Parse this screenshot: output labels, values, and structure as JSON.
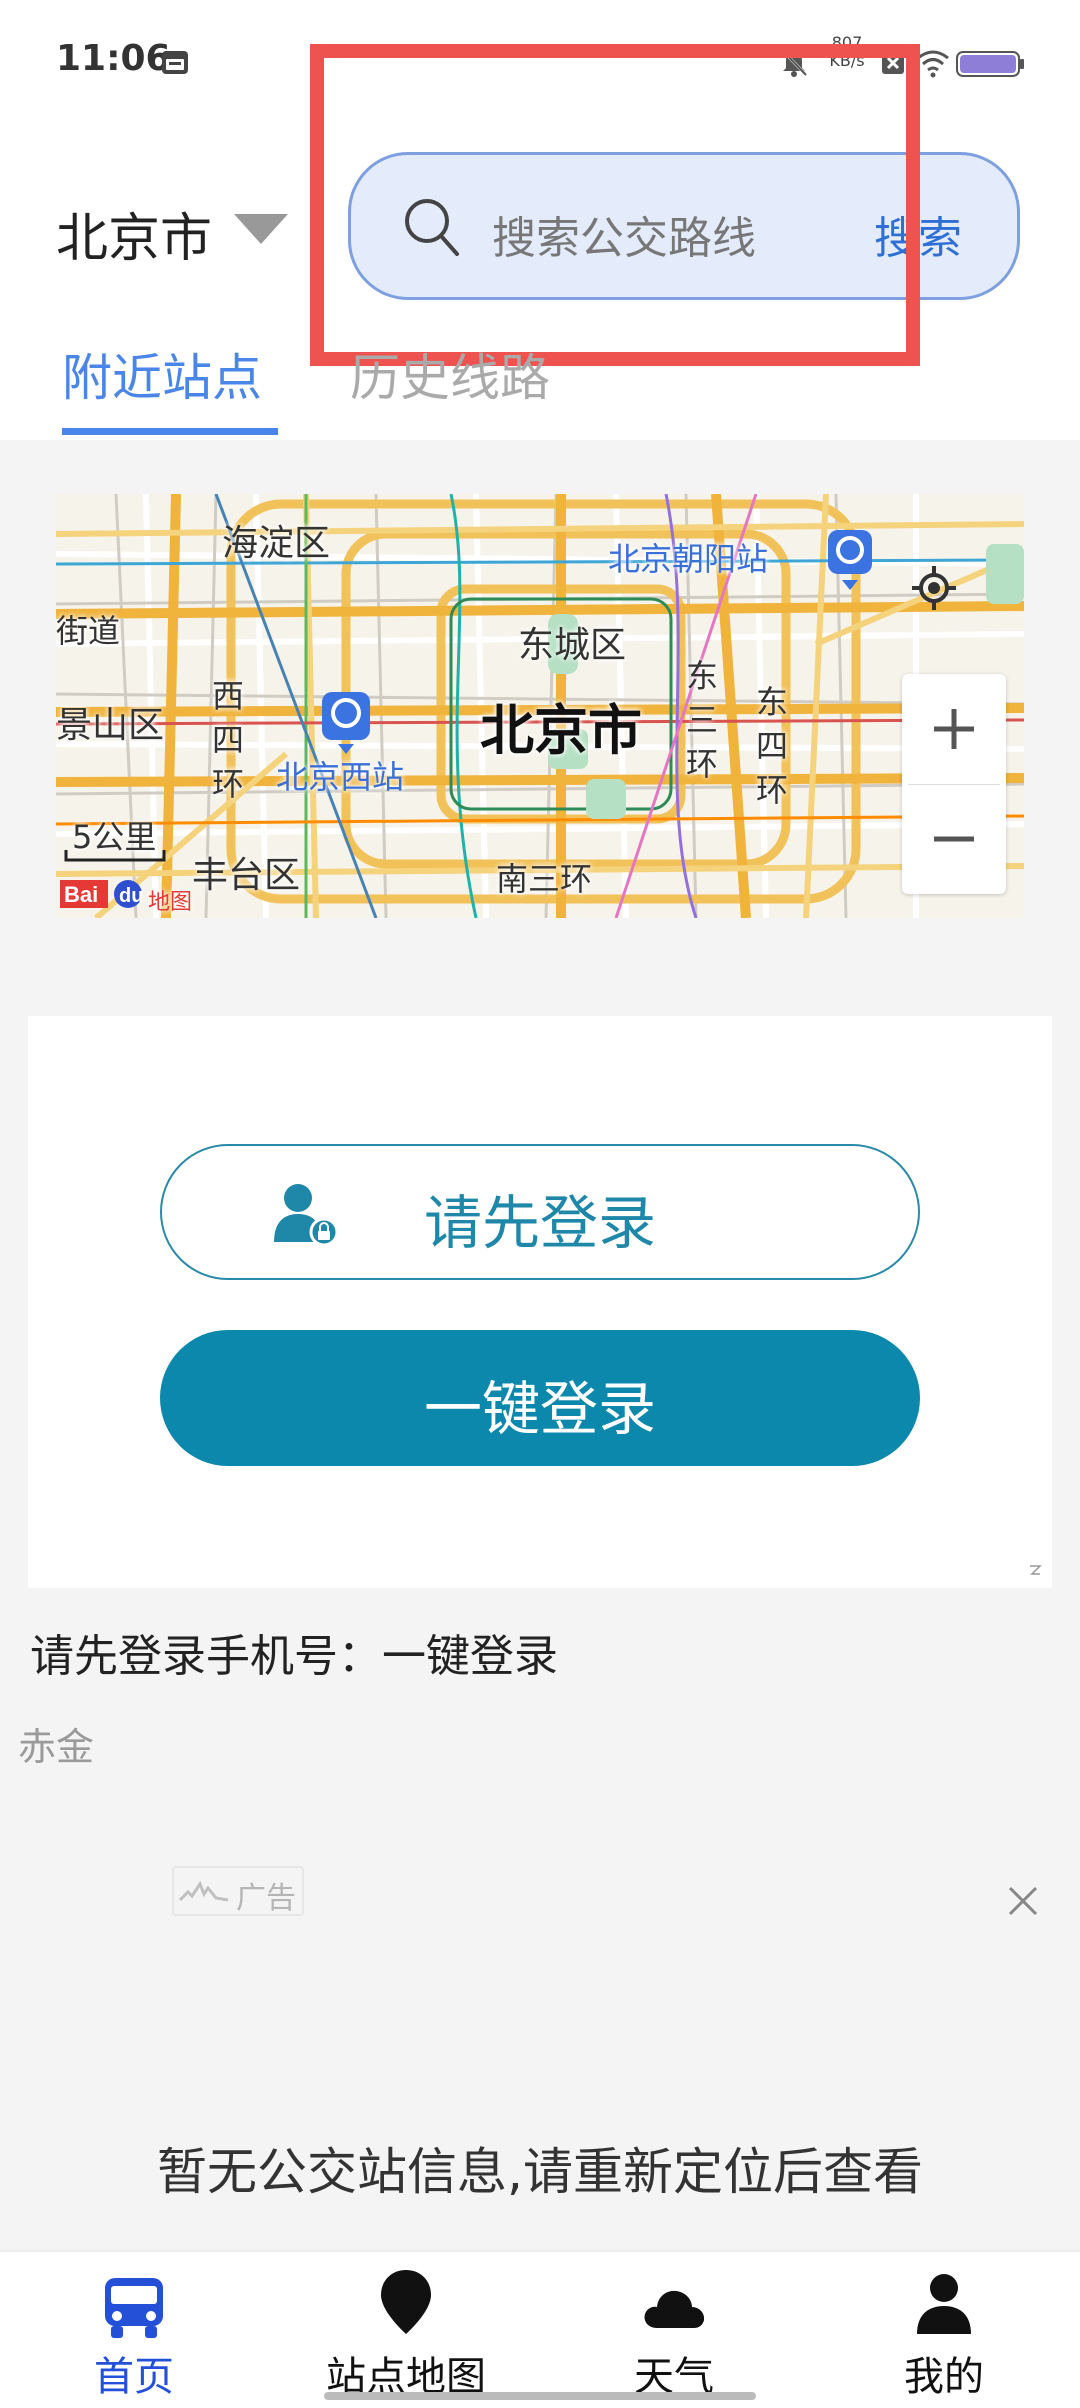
{
  "status_bar": {
    "time": "11:06",
    "net_speed_top": "807",
    "net_speed_unit": "KB/s"
  },
  "header": {
    "city": "北京市",
    "search_placeholder": "搜索公交路线",
    "search_button": "搜索"
  },
  "tabs": [
    {
      "label": "附近站点",
      "active": true
    },
    {
      "label": "历史线路",
      "active": false
    }
  ],
  "map": {
    "labels": {
      "haidian": "海淀区",
      "jiedao": "街道",
      "chaoyang_station": "北京朝阳站",
      "dongcheng": "东城区",
      "jingshan": "景山区",
      "west4": "西四环",
      "east3": "东三环",
      "east4": "东四环",
      "beijing": "北京市",
      "west_station": "北京西站",
      "fengtai": "丰台区",
      "south3": "南三环",
      "scale": "5公里",
      "provider": "地图"
    }
  },
  "login_card": {
    "primary_label": "请先登录",
    "secondary_label": "一键登录"
  },
  "login_hint": "请先登录手机号：一键登录",
  "ad": {
    "brand": "赤金",
    "label": "广告"
  },
  "empty_message": "暂无公交站信息,请重新定位后查看",
  "bottom_nav": [
    {
      "label": "首页",
      "icon": "bus-icon",
      "active": true
    },
    {
      "label": "站点地图",
      "icon": "map-pin-icon",
      "active": false
    },
    {
      "label": "天气",
      "icon": "cloud-icon",
      "active": false
    },
    {
      "label": "我的",
      "icon": "person-icon",
      "active": false
    }
  ],
  "colors": {
    "accent_blue": "#4a86e8",
    "teal": "#0b88ab",
    "nav_active": "#2450d8",
    "annotation_red": "#ef5350"
  }
}
